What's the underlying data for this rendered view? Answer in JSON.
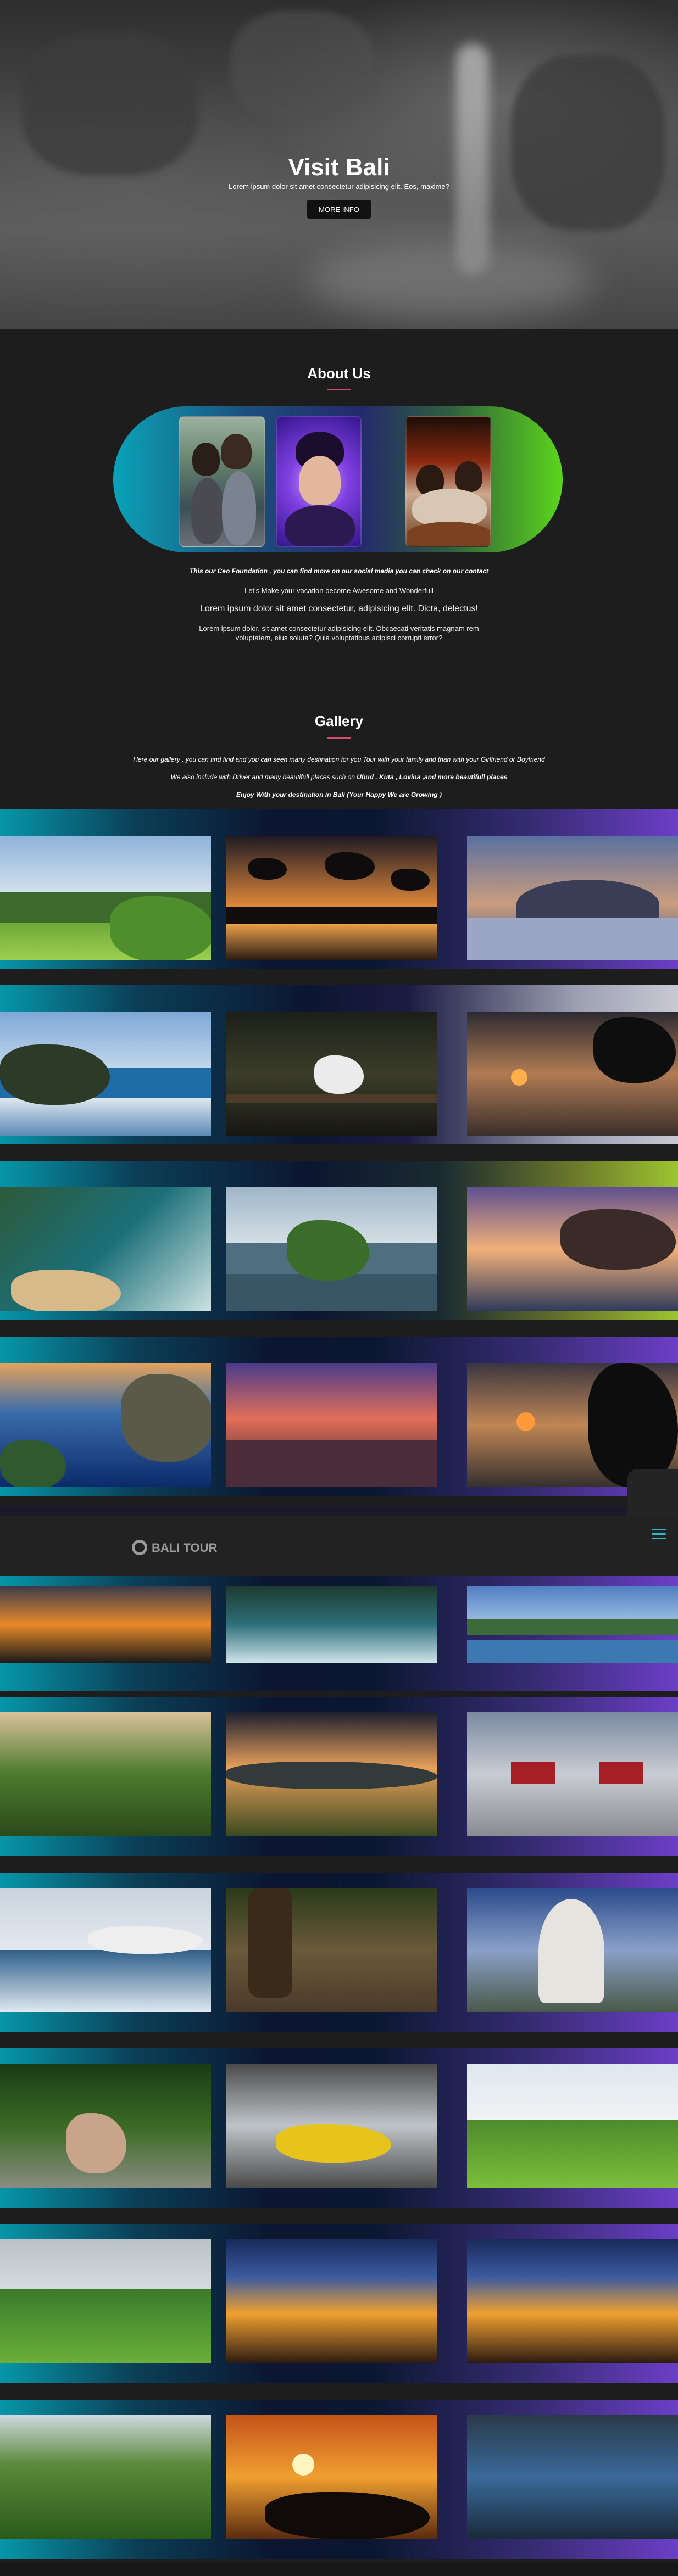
{
  "hero": {
    "title": "Visit Bali",
    "subtitle": "Lorem ipsum dolor sit amet consectetur adipisicing elit. Eos, maxime?",
    "button": "MORE INFO"
  },
  "about": {
    "title": "About Us",
    "caption": "This our Ceo Foundation , you can find more on our social media you can check on our contact",
    "line2": "Let's Make your vacation become Awesome and Wonderfull",
    "line3": "Lorem ipsum dolor sit amet consectetur, adipisicing elit. Dicta, delectus!",
    "line4": "Lorem ipsum dolor, sit amet consectetur adipisicing elit. Obcaecati veritatis magnam rem voluptatem, eius soluta? Quia voluptatibus adipisci corrupti error?"
  },
  "gallery": {
    "title": "Gallery",
    "line1": "Here our gallery , you can find find and you can seen many destination for you Tour with your family and than with your Girlfriend or Boyfriend",
    "line2_prefix": "We also include with Driver and many beautifull places such on",
    "line2_bold": "Ubud , Kuta , Lovina ,and more beautifull places",
    "line3": "Enjoy With your destination in Bali (Your Happy We are Growing )"
  },
  "navbar": {
    "logo": "BALI TOUR"
  },
  "colors": {
    "accent_underline": "#d64a6b",
    "band_teal": "#0796a8",
    "band_purple": "#6b3fc6",
    "hamburger": "#2fb7c7"
  }
}
